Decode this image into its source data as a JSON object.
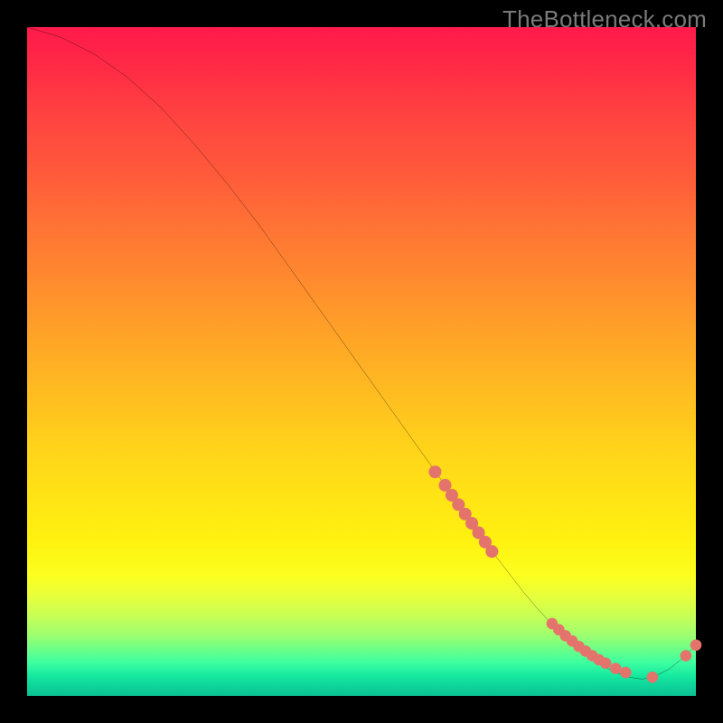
{
  "watermark": "TheBottleneck.com",
  "chart_data": {
    "type": "line",
    "title": "",
    "xlabel": "",
    "ylabel": "",
    "xlim": [
      0,
      100
    ],
    "ylim": [
      0,
      100
    ],
    "grid": false,
    "legend": false,
    "series": [
      {
        "name": "curve",
        "color": "#000000",
        "x": [
          0,
          5,
          10,
          15,
          20,
          25,
          30,
          35,
          40,
          45,
          50,
          55,
          60,
          62,
          64,
          66,
          68,
          70,
          72,
          74,
          76,
          78,
          80,
          82,
          84,
          86,
          88,
          90,
          92,
          94,
          96,
          98,
          99,
          100
        ],
        "y": [
          100,
          98.5,
          96.0,
          92.5,
          88.0,
          82.5,
          76.5,
          70.0,
          63.0,
          56.0,
          49.0,
          42.0,
          35.0,
          32.2,
          29.4,
          26.6,
          23.8,
          21.0,
          18.4,
          15.8,
          13.4,
          11.2,
          9.2,
          7.4,
          5.8,
          4.5,
          3.5,
          2.8,
          2.5,
          3.0,
          4.0,
          5.6,
          6.6,
          7.6
        ]
      }
    ],
    "cluster1": {
      "name": "segment-dots-upper",
      "color": "#e4736c",
      "x": [
        61,
        62.5,
        63.5,
        64.5,
        65.5,
        66.5,
        67.5,
        68.5,
        69.5
      ],
      "y": [
        33.5,
        31.5,
        30.0,
        28.6,
        27.2,
        25.8,
        24.4,
        23.0,
        21.6
      ]
    },
    "cluster2": {
      "name": "bottom-dots",
      "color": "#e4736c",
      "x": [
        78.5,
        79.5,
        80.5,
        81.5,
        82.5,
        83.5,
        84.5,
        85.5,
        86.5,
        88.0,
        89.5,
        93.5
      ],
      "y": [
        10.8,
        9.9,
        9.0,
        8.2,
        7.4,
        6.7,
        6.0,
        5.4,
        4.9,
        4.1,
        3.5,
        2.8
      ]
    },
    "cluster3": {
      "name": "tail-dots",
      "color": "#e4736c",
      "x": [
        98.5,
        100
      ],
      "y": [
        6.0,
        7.6
      ]
    }
  }
}
